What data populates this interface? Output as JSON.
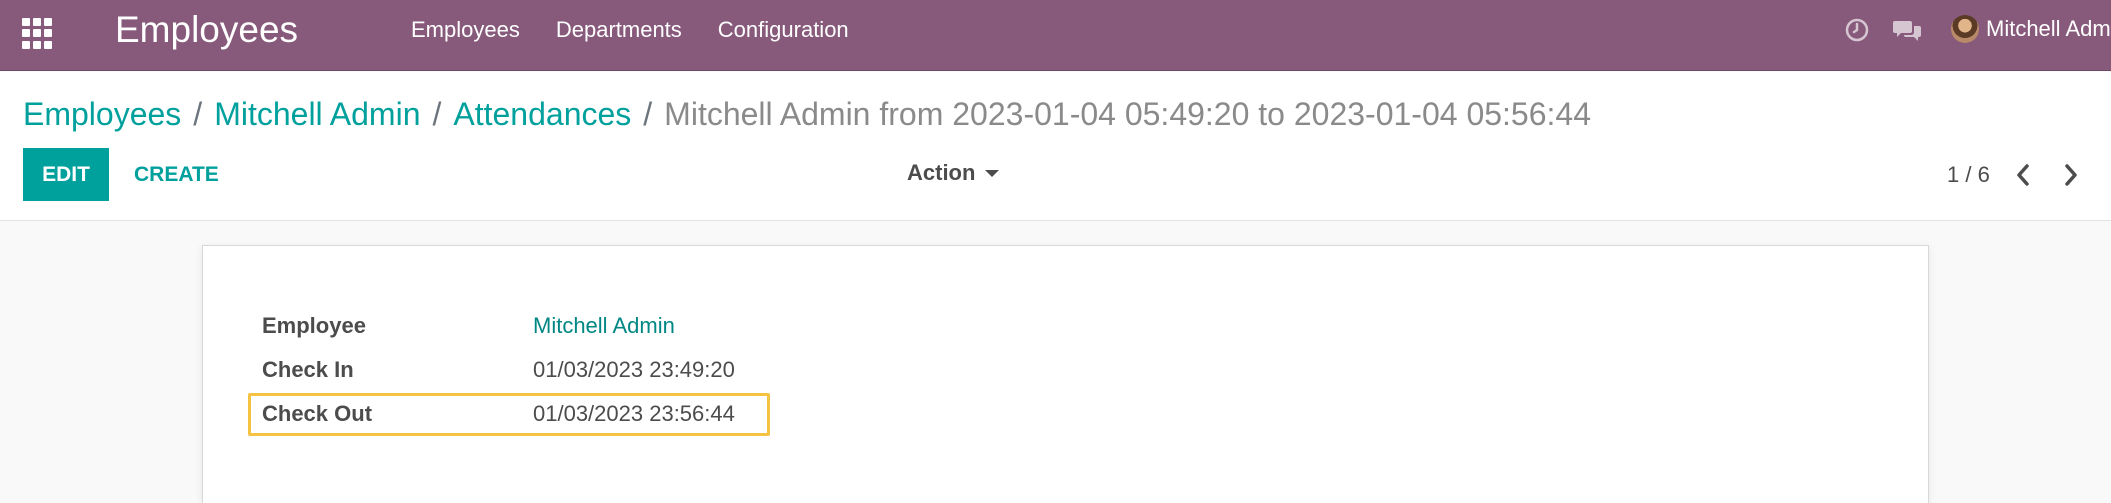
{
  "navbar": {
    "app_title": "Employees",
    "menu": [
      {
        "label": "Employees"
      },
      {
        "label": "Departments"
      },
      {
        "label": "Configuration"
      }
    ],
    "user_name": "Mitchell Admin",
    "icons": [
      "apps-grid-icon",
      "clock-icon",
      "chat-icon"
    ]
  },
  "breadcrumb": {
    "items": [
      "Employees",
      "Mitchell Admin",
      "Attendances"
    ],
    "current": "Mitchell Admin from 2023-01-04 05:49:20 to 2023-01-04 05:56:44",
    "separator": "/"
  },
  "toolbar": {
    "edit_label": "EDIT",
    "create_label": "CREATE",
    "action_label": "Action"
  },
  "pager": {
    "value": "1 / 6"
  },
  "form": {
    "fields": [
      {
        "label": "Employee",
        "value": "Mitchell Admin"
      },
      {
        "label": "Check In",
        "value": "01/03/2023 23:49:20"
      },
      {
        "label": "Check Out",
        "value": "01/03/2023 23:56:44"
      }
    ]
  },
  "colors": {
    "navbar": "#875a7b",
    "accent": "#00a09d",
    "highlight": "#f5c342"
  }
}
